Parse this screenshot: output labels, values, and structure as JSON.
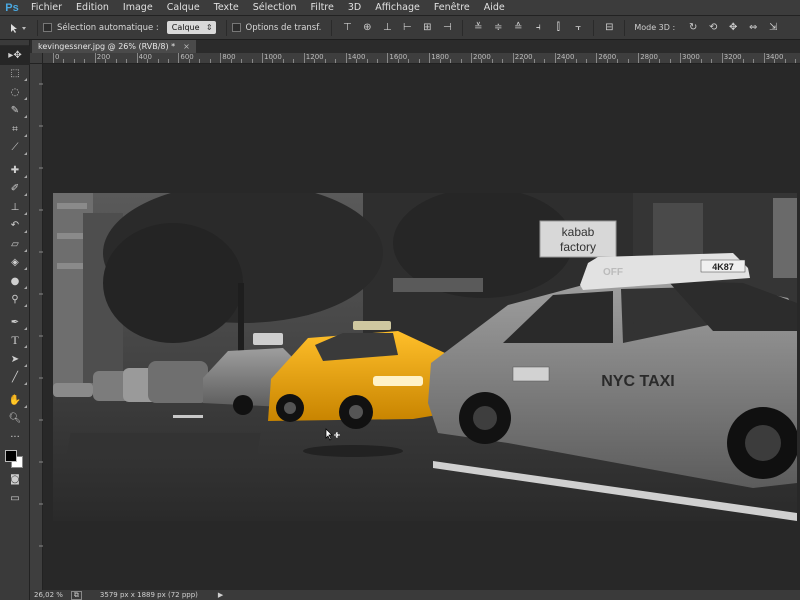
{
  "app": {
    "logo": "Ps"
  },
  "menu": [
    "Fichier",
    "Edition",
    "Image",
    "Calque",
    "Texte",
    "Sélection",
    "Filtre",
    "3D",
    "Affichage",
    "Fenêtre",
    "Aide"
  ],
  "options": {
    "auto_select_label": "Sélection automatique :",
    "auto_select_value": "Calque",
    "transform_label": "Options de transf.",
    "mode3d_label": "Mode 3D :"
  },
  "document": {
    "tab_title": "kevingessner.jpg @ 26% (RVB/8) *",
    "close_glyph": "×"
  },
  "ruler": {
    "top_labels": [
      "0",
      "200",
      "400",
      "600",
      "800",
      "1000",
      "1200",
      "1400",
      "1600",
      "1800",
      "2000",
      "2200",
      "2400",
      "2600",
      "2800",
      "3000",
      "3200",
      "3400"
    ]
  },
  "status": {
    "zoom": "26,02 %",
    "doc_size": "3579 px x 1889 px (72 ppp)"
  },
  "colors": {
    "foreground": "#000000",
    "background": "#ffffff",
    "taxi_yellow": "#f2a818"
  },
  "photo": {
    "shop_sign_lines": [
      "kabab",
      "factory"
    ],
    "roof_sign_text": "4K87",
    "door_text": "NYC TAXI",
    "off_sign_text": "OFF"
  }
}
